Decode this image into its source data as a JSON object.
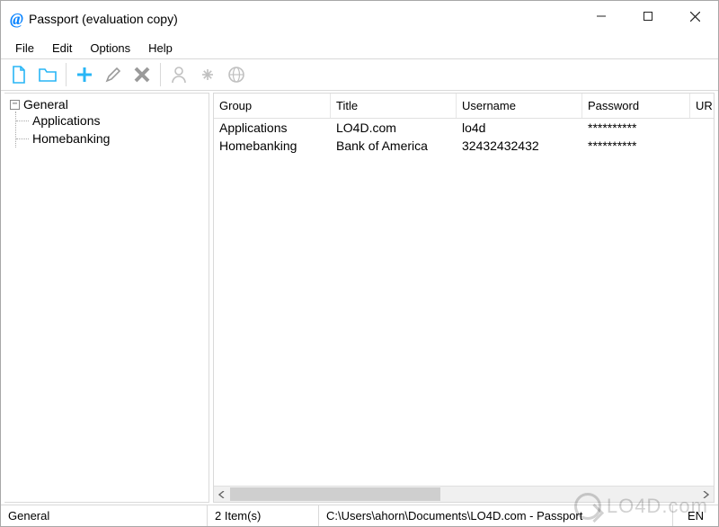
{
  "title": "Passport (evaluation copy)",
  "menubar": {
    "file": "File",
    "edit": "Edit",
    "options": "Options",
    "help": "Help"
  },
  "toolbar": {
    "new": "new-doc",
    "open": "open-folder",
    "add": "add-entry",
    "edit": "edit-entry",
    "delete": "delete-entry",
    "user": "user",
    "password": "password",
    "web": "web"
  },
  "tree": {
    "root_label": "General",
    "children": [
      {
        "label": "Applications"
      },
      {
        "label": "Homebanking"
      }
    ]
  },
  "list": {
    "columns": {
      "group": "Group",
      "title": "Title",
      "username": "Username",
      "password": "Password",
      "url": "UR"
    },
    "rows": [
      {
        "group": "Applications",
        "title": "LO4D.com",
        "username": "lo4d",
        "password": "**********",
        "url": ""
      },
      {
        "group": "Homebanking",
        "title": "Bank of America",
        "username": "32432432432",
        "password": "**********",
        "url": ""
      }
    ]
  },
  "statusbar": {
    "group": "General",
    "items": "2 Item(s)",
    "path": "C:\\Users\\ahorn\\Documents\\LO4D.com - Passport",
    "lang": "EN"
  },
  "watermark": "LO4D.com"
}
